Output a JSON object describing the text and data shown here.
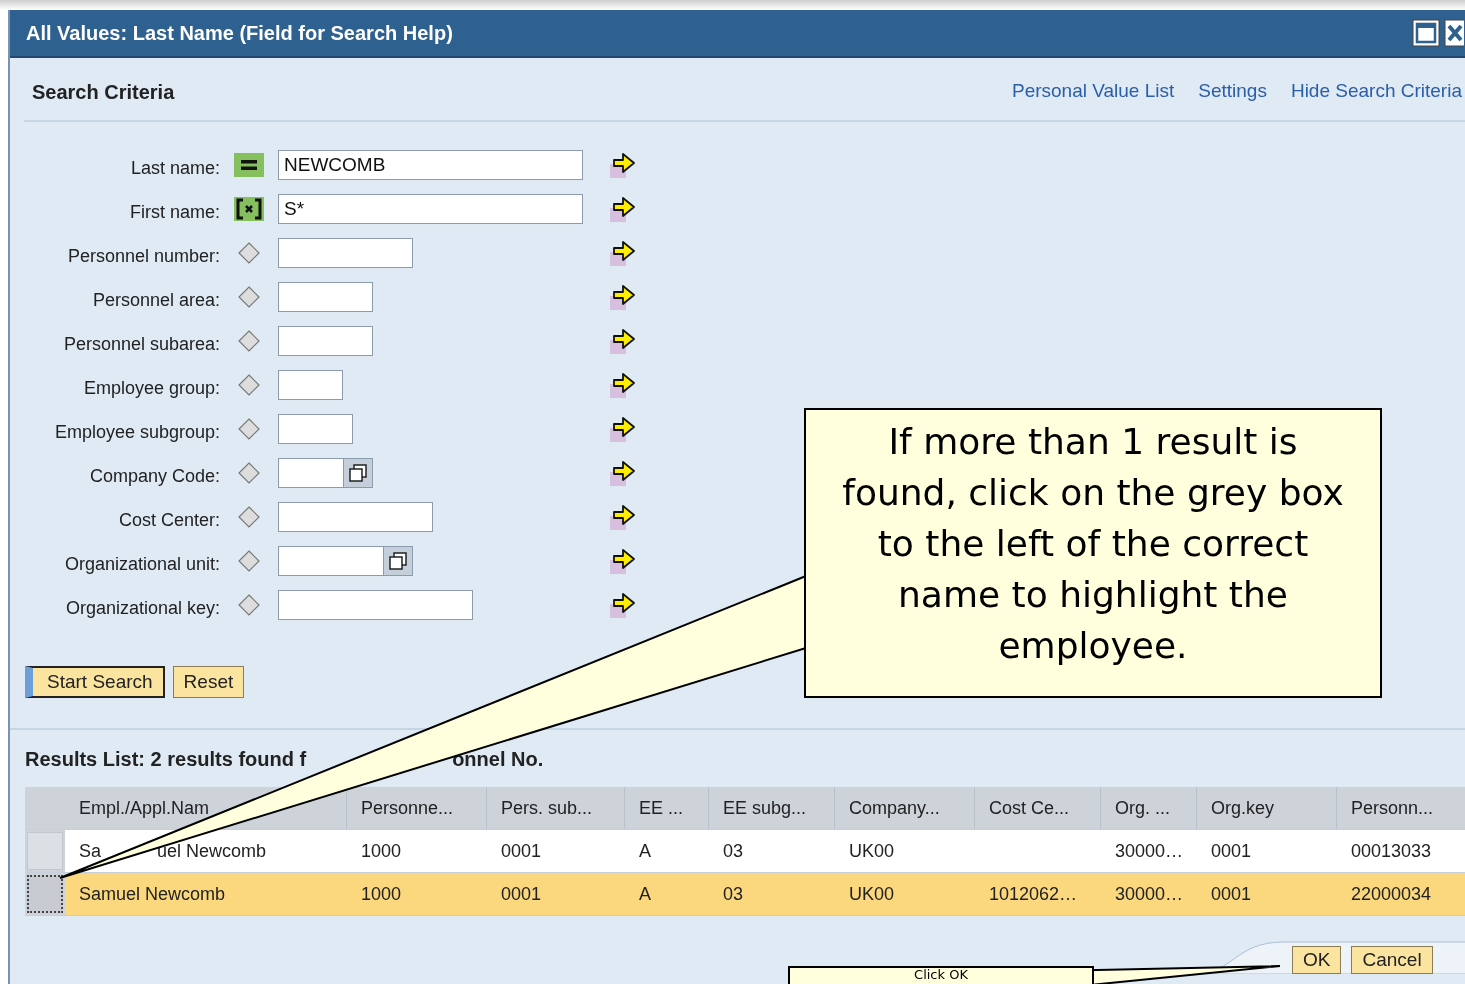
{
  "window": {
    "title": "All Values: Last Name (Field for Search Help)"
  },
  "header": {
    "title": "Search Criteria",
    "links": [
      "Personal Value List",
      "Settings",
      "Hide Search Criteria"
    ]
  },
  "fields": [
    {
      "label": "Last name:",
      "kind": "equal",
      "value": "NEWCOMB",
      "has_help": false
    },
    {
      "label": "First name:",
      "kind": "pattern",
      "value": "S*",
      "has_help": false
    },
    {
      "label": "Personnel number:",
      "kind": "none",
      "has_help": false
    },
    {
      "label": "Personnel area:",
      "kind": "none",
      "has_help": false
    },
    {
      "label": "Personnel subarea:",
      "kind": "none",
      "has_help": false
    },
    {
      "label": "Employee group:",
      "kind": "none",
      "has_help": false
    },
    {
      "label": "Employee subgroup:",
      "kind": "none",
      "has_help": false
    },
    {
      "label": "Company Code:",
      "kind": "none",
      "has_help": true
    },
    {
      "label": "Cost Center:",
      "kind": "none",
      "has_help": false
    },
    {
      "label": "Organizational unit:",
      "kind": "none",
      "has_help": true
    },
    {
      "label": "Organizational key:",
      "kind": "none",
      "has_help": false
    }
  ],
  "actions": [
    {
      "label": "Start Search",
      "focused": true
    },
    {
      "label": "Reset",
      "focused": false
    }
  ],
  "results": {
    "title_parts": [
      "Results List: 2 results found f",
      "onnel No."
    ],
    "columns": [
      "Empl./Appl.Nam",
      "Personne...",
      "Pers. sub...",
      "EE ...",
      "EE subg...",
      "Company...",
      "Cost Ce...",
      "Org. ...",
      "Org.key",
      "Personn..."
    ],
    "rows": [
      {
        "selected": false,
        "cells": [
          [
            "Sa",
            "uel Newcomb"
          ],
          "1000",
          "0001",
          "A",
          "03",
          "UK00",
          null,
          "30000…",
          "0001",
          "00013033"
        ]
      },
      {
        "selected": true,
        "cells": [
          [
            "Samuel Newcomb"
          ],
          "1000",
          "0001",
          "A",
          "03",
          "UK00",
          "1012062…",
          "30000…",
          "0001",
          "22000034"
        ]
      }
    ]
  },
  "footer": {
    "buttons": [
      "OK",
      "Cancel"
    ]
  },
  "callouts": [
    {
      "text": "If more than 1 result is found, click on the grey box to the left of the correct name to highlight the employee."
    },
    {
      "text": "Click OK"
    }
  ]
}
